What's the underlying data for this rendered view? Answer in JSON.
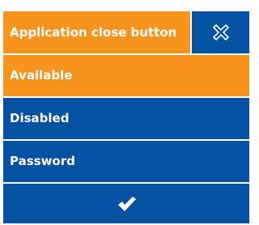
{
  "header": {
    "title": "Application close button",
    "close_icon": "close-icon"
  },
  "options": [
    {
      "label": "Available",
      "selected": true
    },
    {
      "label": "Disabled",
      "selected": false
    },
    {
      "label": "Password",
      "selected": false
    }
  ],
  "confirm": {
    "icon": "checkmark-icon"
  },
  "colors": {
    "accent_orange": "#f7941d",
    "primary_blue": "#0652a2",
    "text": "#ffffff"
  }
}
